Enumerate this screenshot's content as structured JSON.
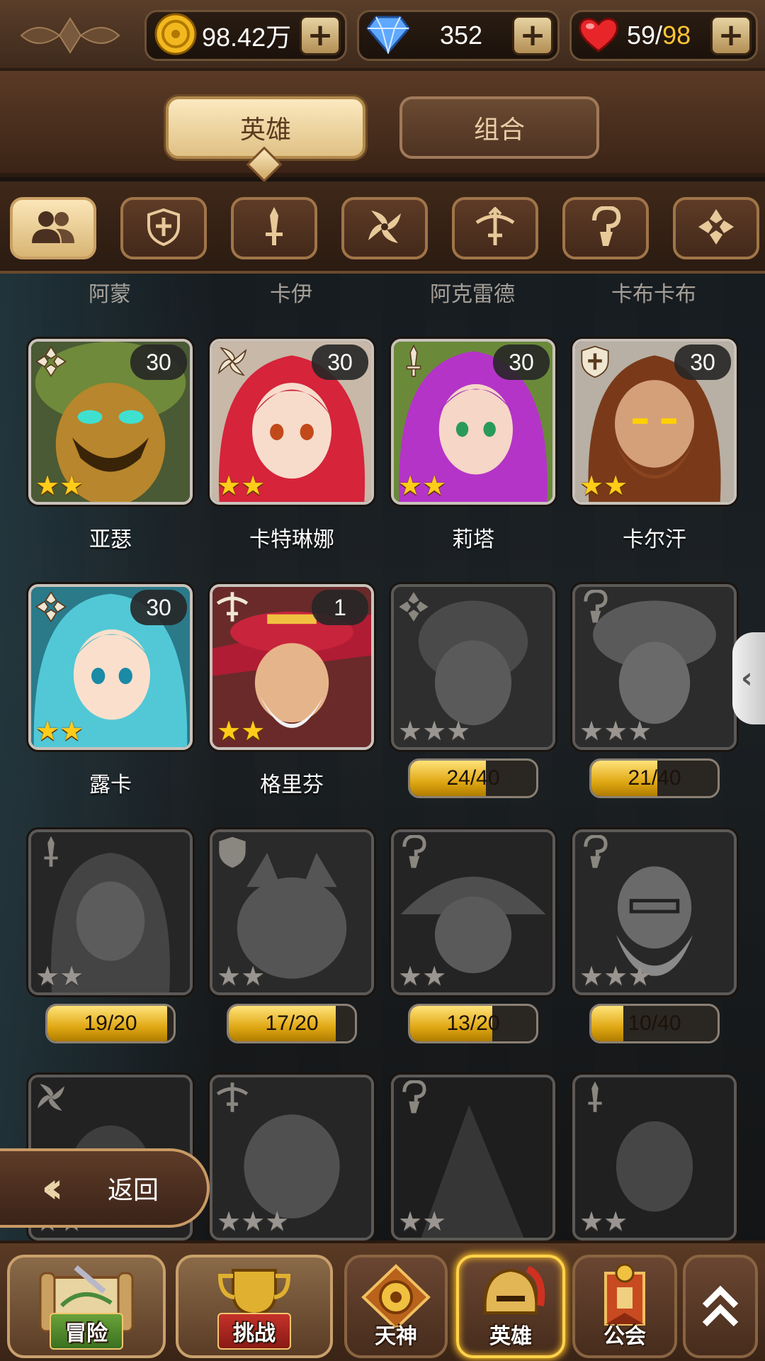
{
  "resources": {
    "gold": "98.42万",
    "gems": "352",
    "stamina_current": "59",
    "stamina_sep": "/",
    "stamina_max": "98"
  },
  "tabs": {
    "heroes": "英雄",
    "combos": "组合"
  },
  "filters": [
    "all-heroes",
    "defender",
    "warrior",
    "assassin",
    "ranger",
    "mage",
    "support"
  ],
  "prev_row_names": [
    "阿蒙",
    "卡伊",
    "阿克雷德",
    "卡布卡布"
  ],
  "heroes": [
    {
      "name": "亚瑟",
      "level": "30",
      "stars": "★★",
      "class": "support"
    },
    {
      "name": "卡特琳娜",
      "level": "30",
      "stars": "★★",
      "class": "assassin"
    },
    {
      "name": "莉塔",
      "level": "30",
      "stars": "★★",
      "class": "warrior"
    },
    {
      "name": "卡尔汗",
      "level": "30",
      "stars": "★★",
      "class": "defender"
    },
    {
      "name": "露卡",
      "level": "30",
      "stars": "★★",
      "class": "support"
    },
    {
      "name": "格里芬",
      "level": "1",
      "stars": "★★",
      "class": "ranger"
    }
  ],
  "locked": [
    {
      "shards": "24/40",
      "progress": 0.6,
      "stars": "★★★",
      "class": "support"
    },
    {
      "shards": "21/40",
      "progress": 0.525,
      "stars": "★★★",
      "class": "mage"
    },
    {
      "shards": "19/20",
      "progress": 0.95,
      "stars": "★★",
      "class": "warrior"
    },
    {
      "shards": "17/20",
      "progress": 0.85,
      "stars": "★★",
      "class": "defender"
    },
    {
      "shards": "13/20",
      "progress": 0.65,
      "stars": "★★",
      "class": "mage"
    },
    {
      "shards": "10/40",
      "progress": 0.25,
      "stars": "★★★",
      "class": "mage"
    },
    {
      "stars": "★★",
      "class": "assassin"
    },
    {
      "stars": "★★★",
      "class": "ranger"
    },
    {
      "stars": "★★",
      "class": "mage"
    },
    {
      "stars": "★★",
      "class": "warrior"
    }
  ],
  "back_label": "返回",
  "nav": {
    "adventure": "冒险",
    "challenge": "挑战",
    "god": "天神",
    "hero": "英雄",
    "guild": "公会"
  }
}
